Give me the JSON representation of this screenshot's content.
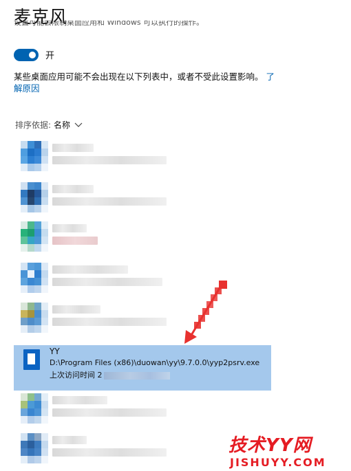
{
  "header": {
    "title": "麦克风"
  },
  "description_clipped": "设置可能会限制桌面应用和 Windows 可以执行的操作。",
  "toggle": {
    "label": "开",
    "state": "on",
    "color": "#0063b1"
  },
  "notice": {
    "text": "某些桌面应用可能不会出现在以下列表中，或者不受此设置影响。",
    "link": "了解原因"
  },
  "sort": {
    "label": "排序依据:",
    "value": "名称"
  },
  "selected_app": {
    "name": "YY",
    "path": "D:\\Program Files (x86)\\duowan\\yy\\9.7.0.0\\yyp2psrv.exe",
    "last_access_label": "上次访问时间 2",
    "highlight_color": "#a4c8ec"
  },
  "watermark": {
    "brand": "技术YY网",
    "url": "JISHUYY.COM",
    "color": "#e51c23"
  }
}
